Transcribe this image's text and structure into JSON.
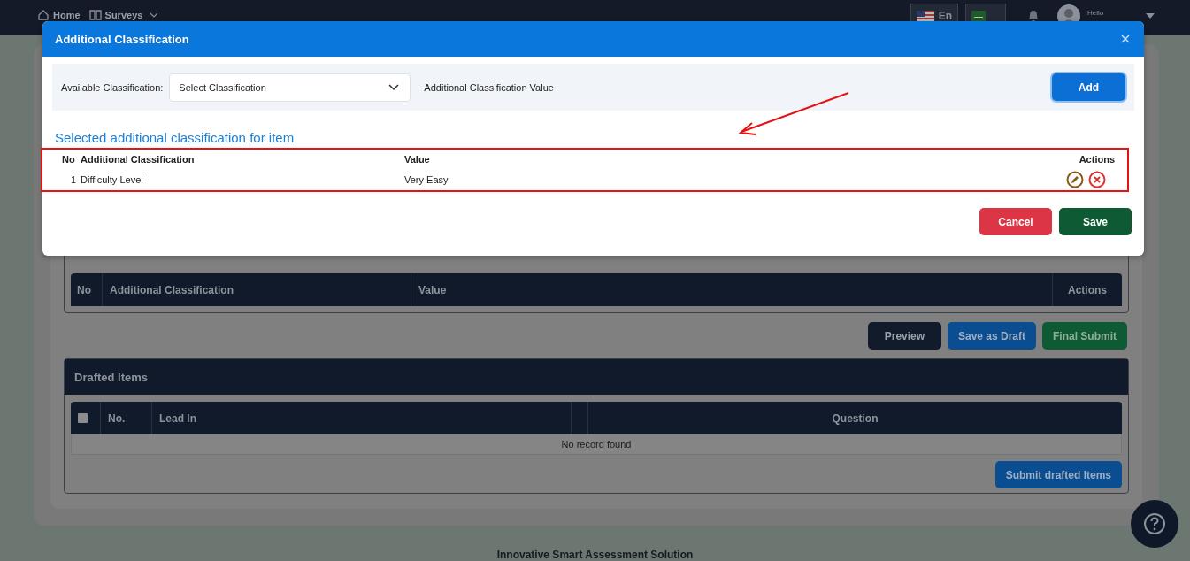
{
  "top_bar": {
    "nav": [
      {
        "label": "Home",
        "dropdown": false
      },
      {
        "label": "Surveys",
        "dropdown": true
      }
    ],
    "language": {
      "label": "En"
    },
    "user": {
      "greeting": "Hello"
    }
  },
  "page": {
    "classification_table": {
      "columns": [
        "No",
        "Additional Classification",
        "Value",
        "Actions"
      ]
    },
    "buttons": [
      {
        "label": "Preview",
        "kind": "dark"
      },
      {
        "label": "Save as Draft",
        "kind": "primary"
      },
      {
        "label": "Final Submit",
        "kind": "success"
      }
    ],
    "drafted_items": {
      "title": "Drafted Items",
      "columns": [
        {
          "kind": "checkbox",
          "checked": false
        },
        {
          "kind": "text",
          "label": "No."
        },
        {
          "kind": "text",
          "label": "Lead In"
        },
        {
          "kind": "blank"
        },
        {
          "kind": "center",
          "label": "Question"
        }
      ],
      "empty_message": "No record found",
      "submit_button": "Submit drafted Items"
    }
  },
  "footer": "Innovative Smart Assessment Solution",
  "modal": {
    "title": "Additional Classification",
    "filter": {
      "label": "Available Classification:",
      "select_placeholder": "Select Classification",
      "value_label": "Additional Classification Value",
      "add_button": "Add"
    },
    "section_title": "Selected additional classification for item",
    "table": {
      "columns": [
        "No",
        "Additional Classification",
        "Value",
        "Actions"
      ],
      "rows": [
        {
          "no": "1",
          "classification": "Difficulty Level",
          "value": "Very Easy"
        }
      ]
    },
    "buttons": [
      {
        "label": "Cancel",
        "kind": "danger"
      },
      {
        "label": "Save",
        "kind": "success"
      }
    ]
  },
  "annotations": {
    "highlight_box": true,
    "arrow": true
  }
}
